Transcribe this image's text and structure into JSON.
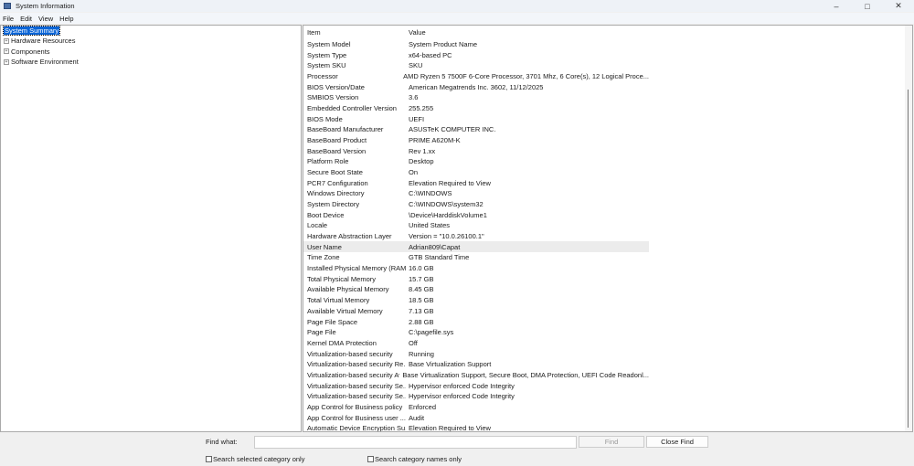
{
  "window": {
    "title": "System Information"
  },
  "menu": [
    "File",
    "Edit",
    "View",
    "Help"
  ],
  "tree": [
    {
      "label": "System Summary",
      "selected": true
    },
    {
      "label": "Hardware Resources"
    },
    {
      "label": "Components"
    },
    {
      "label": "Software Environment"
    }
  ],
  "table": {
    "headers": [
      "Item",
      "Value"
    ],
    "rows": [
      [
        "System Model",
        "System Product Name"
      ],
      [
        "System Type",
        "x64-based PC"
      ],
      [
        "System SKU",
        "SKU"
      ],
      [
        "Processor",
        "AMD Ryzen 5 7500F 6-Core Processor, 3701 Mhz, 6 Core(s), 12 Logical Proce..."
      ],
      [
        "BIOS Version/Date",
        "American Megatrends Inc. 3602, 11/12/2025"
      ],
      [
        "SMBIOS Version",
        "3.6"
      ],
      [
        "Embedded Controller Version",
        "255.255"
      ],
      [
        "BIOS Mode",
        "UEFI"
      ],
      [
        "BaseBoard Manufacturer",
        "ASUSTeK COMPUTER INC."
      ],
      [
        "BaseBoard Product",
        "PRIME A620M-K"
      ],
      [
        "BaseBoard Version",
        "Rev 1.xx"
      ],
      [
        "Platform Role",
        "Desktop"
      ],
      [
        "Secure Boot State",
        "On"
      ],
      [
        "PCR7 Configuration",
        "Elevation Required to View"
      ],
      [
        "Windows Directory",
        "C:\\WINDOWS"
      ],
      [
        "System Directory",
        "C:\\WINDOWS\\system32"
      ],
      [
        "Boot Device",
        "\\Device\\HarddiskVolume1"
      ],
      [
        "Locale",
        "United States"
      ],
      [
        "Hardware Abstraction Layer",
        "Version = \"10.0.26100.1\""
      ],
      [
        "User Name",
        "Adrian809\\Capat"
      ],
      [
        "Time Zone",
        "GTB Standard Time"
      ],
      [
        "Installed Physical Memory (RAM)",
        "16.0 GB"
      ],
      [
        "Total Physical Memory",
        "15.7 GB"
      ],
      [
        "Available Physical Memory",
        "8.45 GB"
      ],
      [
        "Total Virtual Memory",
        "18.5 GB"
      ],
      [
        "Available Virtual Memory",
        "7.13 GB"
      ],
      [
        "Page File Space",
        "2.88 GB"
      ],
      [
        "Page File",
        "C:\\pagefile.sys"
      ],
      [
        "Kernel DMA Protection",
        "Off"
      ],
      [
        "Virtualization-based security",
        "Running"
      ],
      [
        "Virtualization-based security Re...",
        "Base Virtualization Support"
      ],
      [
        "Virtualization-based security Av...",
        "Base Virtualization Support, Secure Boot, DMA Protection, UEFI Code Readonl..."
      ],
      [
        "Virtualization-based security Se...",
        "Hypervisor enforced Code Integrity"
      ],
      [
        "Virtualization-based security Se...",
        "Hypervisor enforced Code Integrity"
      ],
      [
        "App Control for Business policy",
        "Enforced"
      ],
      [
        "App Control for Business user ...",
        "Audit"
      ],
      [
        "Automatic Device Encryption Su...",
        "Elevation Required to View"
      ]
    ],
    "highlighted_row": 19
  },
  "find": {
    "label": "Find what:",
    "value": "",
    "find_button": "Find",
    "close_button": "Close Find",
    "opt1": "Search selected category only",
    "opt2": "Search category names only"
  }
}
